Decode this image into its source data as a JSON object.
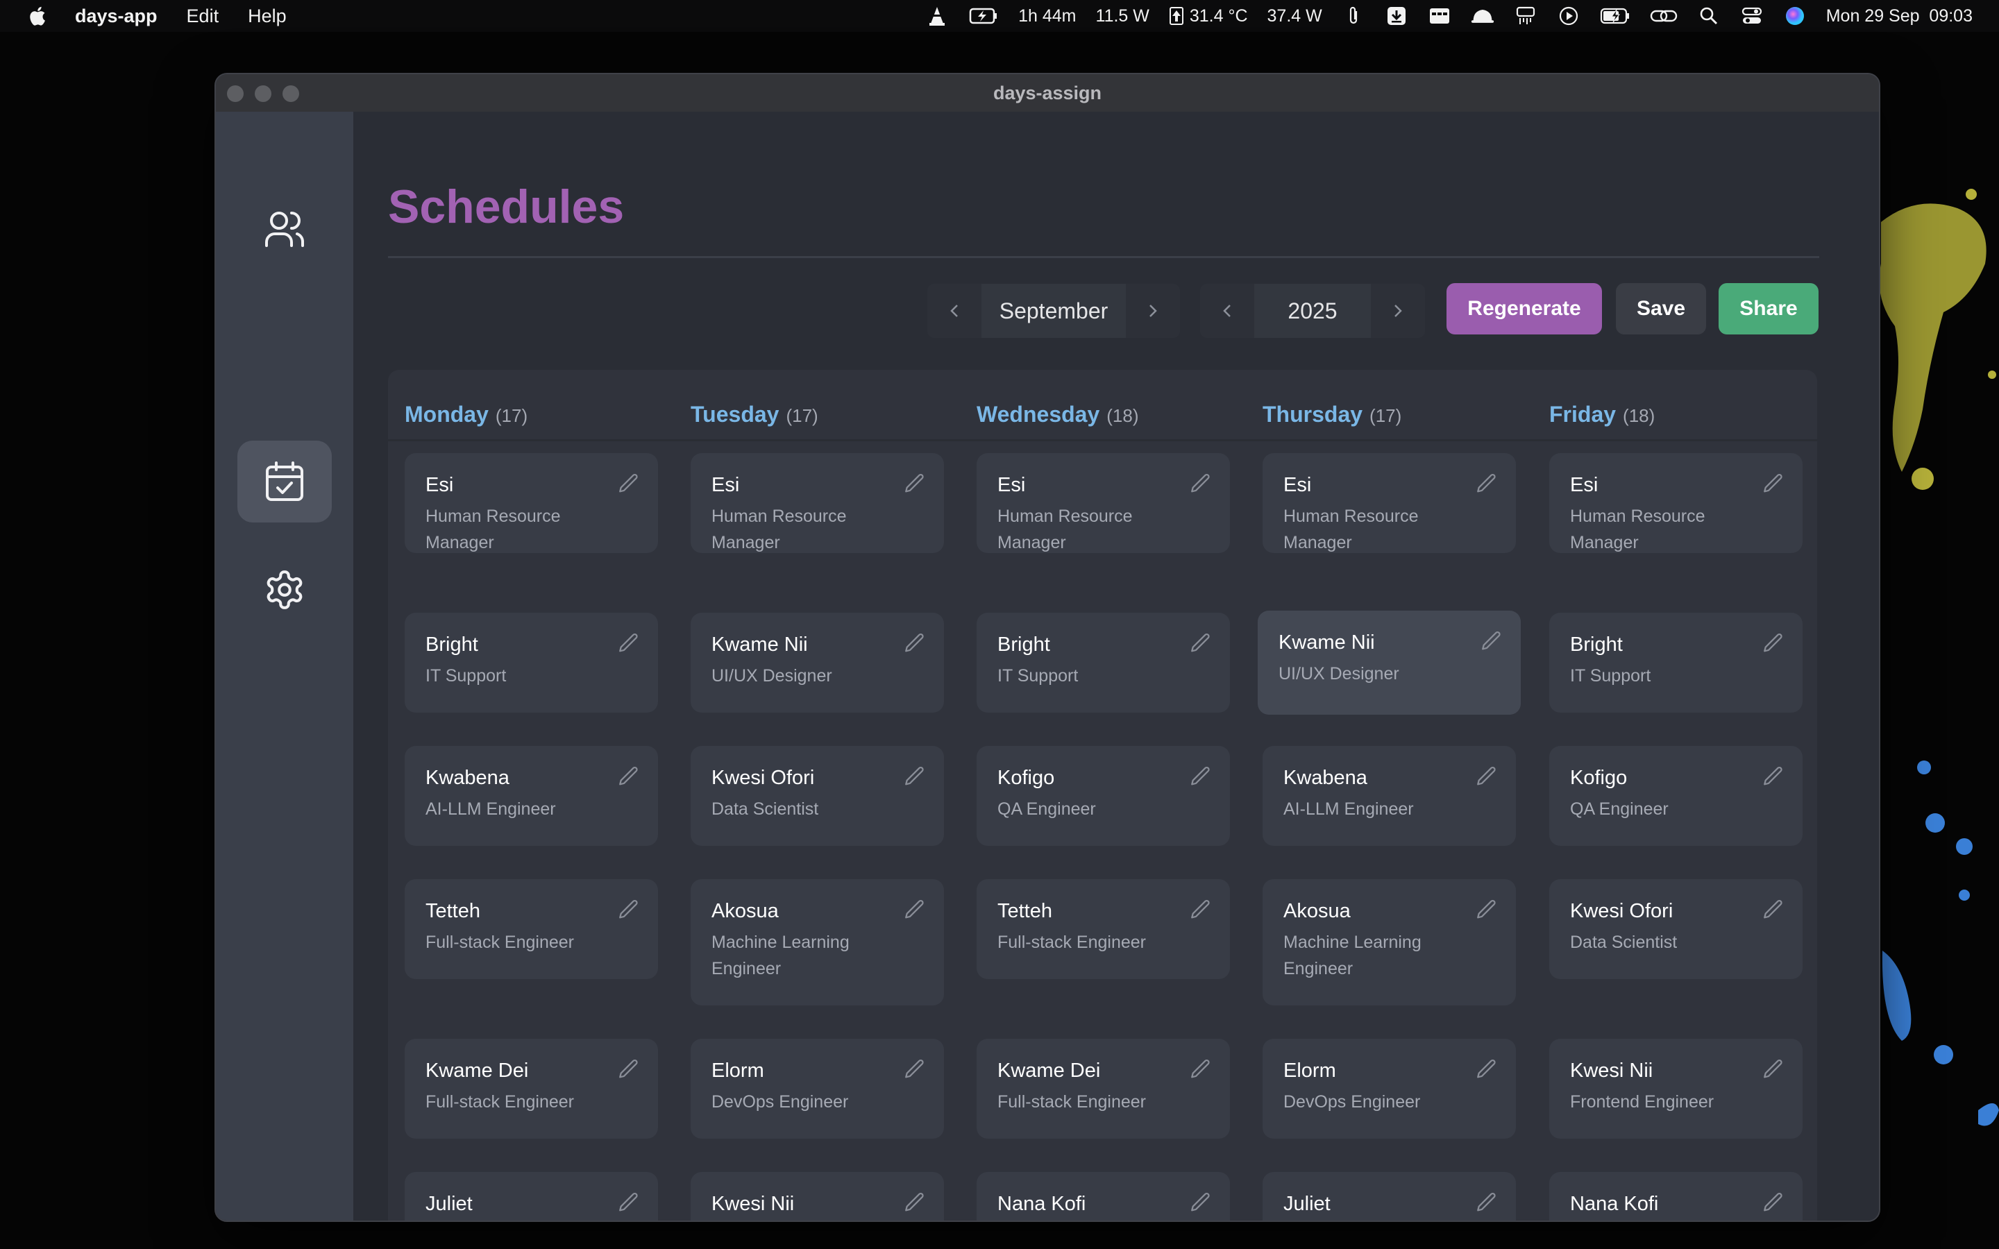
{
  "menubar": {
    "app_name": "days-app",
    "menus": [
      "Edit",
      "Help"
    ],
    "status": {
      "battery_time": "1h 44m",
      "power_in": "11.5 W",
      "temperature": "31.4 °C",
      "power_out": "37.4 W",
      "datetime": "Mon 29 Sep  09:03"
    }
  },
  "window": {
    "title": "days-assign"
  },
  "sidebar": {
    "items": [
      "users-icon",
      "calendar-check-icon",
      "settings-gear-icon"
    ],
    "active": "calendar-check-icon"
  },
  "page": {
    "title": "Schedules"
  },
  "toolbar": {
    "month": "September",
    "year": "2025",
    "regenerate_label": "Regenerate",
    "save_label": "Save",
    "share_label": "Share",
    "colors": {
      "regenerate": "#9a5dae",
      "save": "#3a3d45",
      "share": "#4aaa79"
    }
  },
  "days": [
    {
      "name": "Monday",
      "count": "(17)"
    },
    {
      "name": "Tuesday",
      "count": "(17)"
    },
    {
      "name": "Wednesday",
      "count": "(18)"
    },
    {
      "name": "Thursday",
      "count": "(17)"
    },
    {
      "name": "Friday",
      "count": "(18)"
    }
  ],
  "schedule": [
    [
      {
        "name": "Esi",
        "role": "Human Resource Manager"
      },
      {
        "name": "Esi",
        "role": "Human Resource Manager"
      },
      {
        "name": "Esi",
        "role": "Human Resource Manager"
      },
      {
        "name": "Esi",
        "role": "Human Resource Manager"
      },
      {
        "name": "Esi",
        "role": "Human Resource Manager"
      }
    ],
    [
      {
        "name": "Bright",
        "role": "IT Support"
      },
      {
        "name": "Kwame Nii",
        "role": "UI/UX Designer"
      },
      {
        "name": "Bright",
        "role": "IT Support"
      },
      {
        "name": "Kwame Nii",
        "role": "UI/UX Designer"
      },
      {
        "name": "Bright",
        "role": "IT Support"
      }
    ],
    [
      {
        "name": "Kwabena",
        "role": "AI-LLM Engineer"
      },
      {
        "name": "Kwesi Ofori",
        "role": "Data Scientist"
      },
      {
        "name": "Kofigo",
        "role": "QA Engineer"
      },
      {
        "name": "Kwabena",
        "role": "AI-LLM Engineer"
      },
      {
        "name": "Kofigo",
        "role": "QA Engineer"
      }
    ],
    [
      {
        "name": "Tetteh",
        "role": "Full-stack Engineer"
      },
      {
        "name": "Akosua",
        "role": "Machine Learning Engineer"
      },
      {
        "name": "Tetteh",
        "role": "Full-stack Engineer"
      },
      {
        "name": "Akosua",
        "role": "Machine Learning Engineer"
      },
      {
        "name": "Kwesi Ofori",
        "role": "Data Scientist"
      }
    ],
    [
      {
        "name": "Kwame Dei",
        "role": "Full-stack Engineer"
      },
      {
        "name": "Elorm",
        "role": "DevOps Engineer"
      },
      {
        "name": "Kwame Dei",
        "role": "Full-stack Engineer"
      },
      {
        "name": "Elorm",
        "role": "DevOps Engineer"
      },
      {
        "name": "Kwesi Nii",
        "role": "Frontend Engineer"
      }
    ],
    [
      {
        "name": "Juliet",
        "role": ""
      },
      {
        "name": "Kwesi Nii",
        "role": ""
      },
      {
        "name": "Nana Kofi",
        "role": ""
      },
      {
        "name": "Juliet",
        "role": ""
      },
      {
        "name": "Nana Kofi",
        "role": ""
      }
    ]
  ]
}
